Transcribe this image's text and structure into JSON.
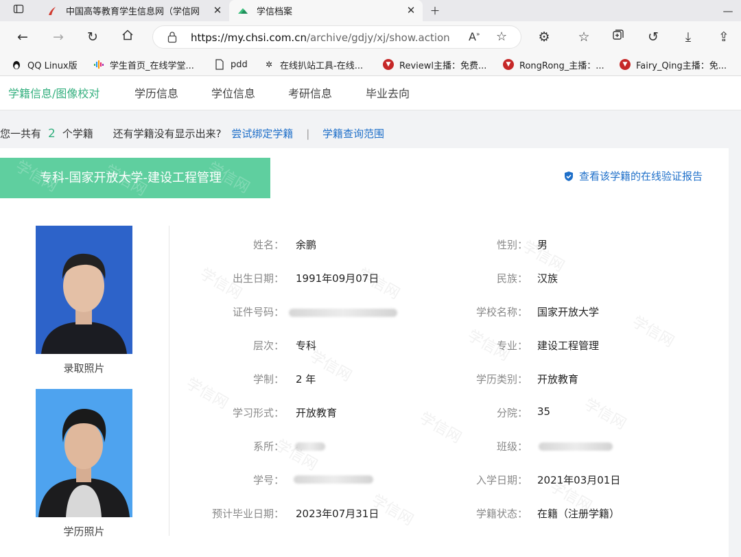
{
  "browser": {
    "tabs": [
      {
        "title": "中国高等教育学生信息网（学信网",
        "icon": "chsi-logo-icon"
      },
      {
        "title": "学信档案",
        "icon": "archive-logo-icon"
      }
    ],
    "url_host": "https://my.chsi.com.cn",
    "url_path": "/archive/gdjy/xj/show.action",
    "bookmarks": [
      {
        "label": "QQ Linux版",
        "icon": "penguin-icon"
      },
      {
        "label": "学生首页_在线学堂...",
        "icon": "waveform-icon"
      },
      {
        "label": "pdd",
        "icon": "page-icon"
      },
      {
        "label": "在线扒站工具-在线...",
        "icon": "bug-icon"
      },
      {
        "label": "Reviewl主播：免费...",
        "icon": "red-logo-icon"
      },
      {
        "label": "RongRong_主播：...",
        "icon": "red-logo-icon"
      },
      {
        "label": "Fairy_Qing主播：免...",
        "icon": "red-logo-icon"
      }
    ]
  },
  "site_nav": {
    "items": [
      "学籍信息/图像校对",
      "学历信息",
      "学位信息",
      "考研信息",
      "毕业去向"
    ],
    "active_index": 0
  },
  "summary": {
    "prefix": "您一共有",
    "count": "2",
    "unit": "个学籍",
    "question": "还有学籍没有显示出来?",
    "bind_link": "尝试绑定学籍",
    "separator": "|",
    "scope_link": "学籍查询范围"
  },
  "record": {
    "banner": "专科-国家开放大学-建设工程管理",
    "verify_link": "查看该学籍的在线验证报告",
    "photo_captions": [
      "录取照片",
      "学历照片"
    ],
    "watermark": "学信网",
    "fields_left": [
      {
        "label": "姓名：",
        "value": "余鹏"
      },
      {
        "label": "出生日期：",
        "value": "1991年09月07日"
      },
      {
        "label": "证件号码：",
        "value": ""
      },
      {
        "label": "层次：",
        "value": "专科"
      },
      {
        "label": "学制：",
        "value": "2 年"
      },
      {
        "label": "学习形式：",
        "value": "开放教育"
      },
      {
        "label": "系所：",
        "value": ""
      },
      {
        "label": "学号：",
        "value": ""
      },
      {
        "label": "预计毕业日期：",
        "value": "2023年07月31日"
      }
    ],
    "fields_right": [
      {
        "label": "性别：",
        "value": "男"
      },
      {
        "label": "民族：",
        "value": "汉族"
      },
      {
        "label": "学校名称：",
        "value": "国家开放大学"
      },
      {
        "label": "专业：",
        "value": "建设工程管理"
      },
      {
        "label": "学历类别：",
        "value": "开放教育"
      },
      {
        "label": "分院：",
        "value": "35"
      },
      {
        "label": "班级：",
        "value": ""
      },
      {
        "label": "入学日期：",
        "value": "2021年03月01日"
      },
      {
        "label": "学籍状态：",
        "value": "在籍（注册学籍）"
      }
    ]
  },
  "colors": {
    "accent": "#5fcf9f",
    "link": "#1e6fc9",
    "active_nav": "#35b07f"
  }
}
